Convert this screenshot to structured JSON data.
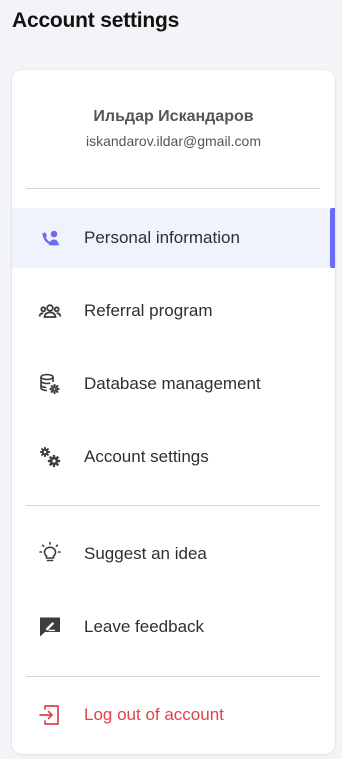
{
  "page": {
    "title": "Account settings"
  },
  "profile": {
    "name": "Ильдар Искандаров",
    "email": "iskandarov.ildar@gmail.com"
  },
  "menu": {
    "personal": {
      "label": "Personal information",
      "icon": "person-icon",
      "active": true
    },
    "referral": {
      "label": "Referral program",
      "icon": "users-icon"
    },
    "database": {
      "label": "Database management",
      "icon": "database-gear-icon"
    },
    "account": {
      "label": "Account settings",
      "icon": "gears-icon"
    },
    "idea": {
      "label": "Suggest an idea",
      "icon": "lightbulb-icon"
    },
    "feedback": {
      "label": "Leave feedback",
      "icon": "feedback-icon"
    },
    "logout": {
      "label": "Log out of account",
      "icon": "logout-icon"
    }
  },
  "colors": {
    "accent": "#6b6cf5",
    "danger": "#e0424b",
    "icon": "#3d3d3d"
  }
}
